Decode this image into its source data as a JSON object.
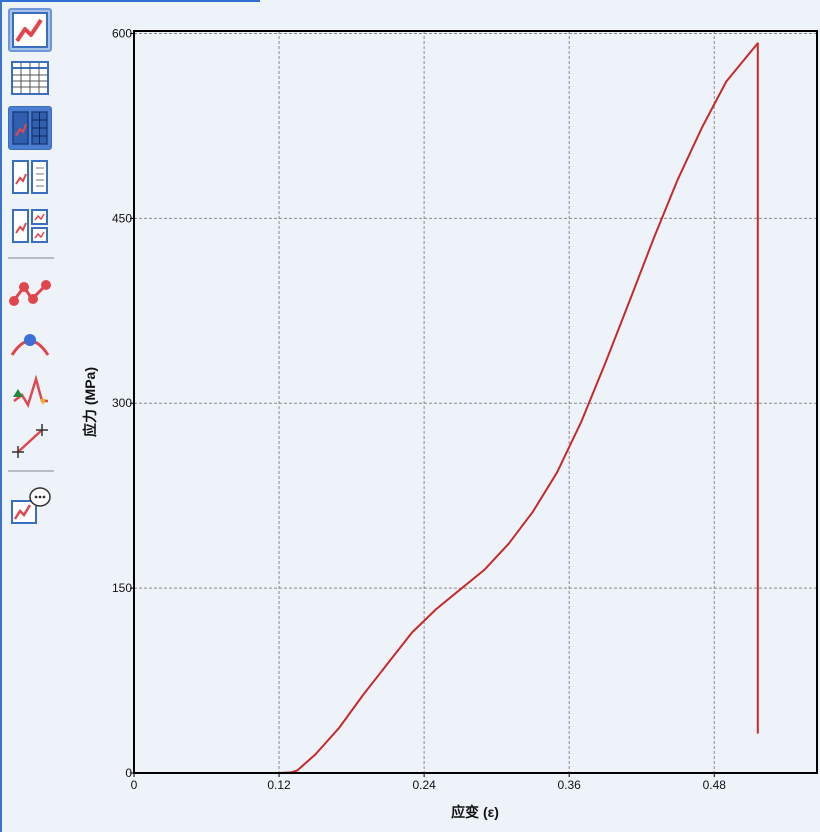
{
  "toolbar": {
    "tools": [
      {
        "name": "chart-view-icon",
        "active": true
      },
      {
        "name": "table-view-icon",
        "active": false
      },
      {
        "name": "chart-table-split-icon",
        "active": true
      },
      {
        "name": "chart-list-split-icon",
        "active": false
      },
      {
        "name": "multi-chart-icon",
        "active": false
      },
      {
        "name": "data-points-icon",
        "active": false
      },
      {
        "name": "peak-marker-icon",
        "active": false
      },
      {
        "name": "peak-valley-icon",
        "active": false
      },
      {
        "name": "crosshair-line-icon",
        "active": false
      },
      {
        "name": "chart-comment-icon",
        "active": false
      }
    ]
  },
  "chart_data": {
    "type": "line",
    "xlabel": "应变 (ε)",
    "ylabel": "应力 (MPa)",
    "xlim": [
      0,
      0.565
    ],
    "ylim": [
      0,
      602
    ],
    "x_ticks": [
      0,
      0.12,
      0.24,
      0.36,
      0.48
    ],
    "x_tick_labels": [
      "0",
      "0.12",
      "0.24",
      "0.36",
      "0.48"
    ],
    "y_ticks": [
      0,
      150,
      300,
      450,
      600
    ],
    "y_tick_labels": [
      "0",
      "150",
      "300",
      "450",
      "600"
    ],
    "grid": true,
    "colors": {
      "series": "#c62a2a",
      "grid": "#8a8a8a",
      "frame": "#000000"
    },
    "series": [
      {
        "x": [
          0,
          0.12,
          0.13,
          0.135,
          0.15,
          0.17,
          0.19,
          0.21,
          0.23,
          0.25,
          0.27,
          0.29,
          0.31,
          0.33,
          0.35,
          0.37,
          0.39,
          0.41,
          0.43,
          0.45,
          0.47,
          0.49,
          0.51,
          0.516,
          0.516,
          0.516
        ],
        "y": [
          0,
          0,
          0.5,
          2,
          15,
          37,
          64,
          89,
          114,
          133,
          149,
          165,
          186,
          212,
          244,
          285,
          333,
          383,
          434,
          482,
          524,
          561,
          585,
          592,
          300,
          32
        ]
      }
    ]
  }
}
